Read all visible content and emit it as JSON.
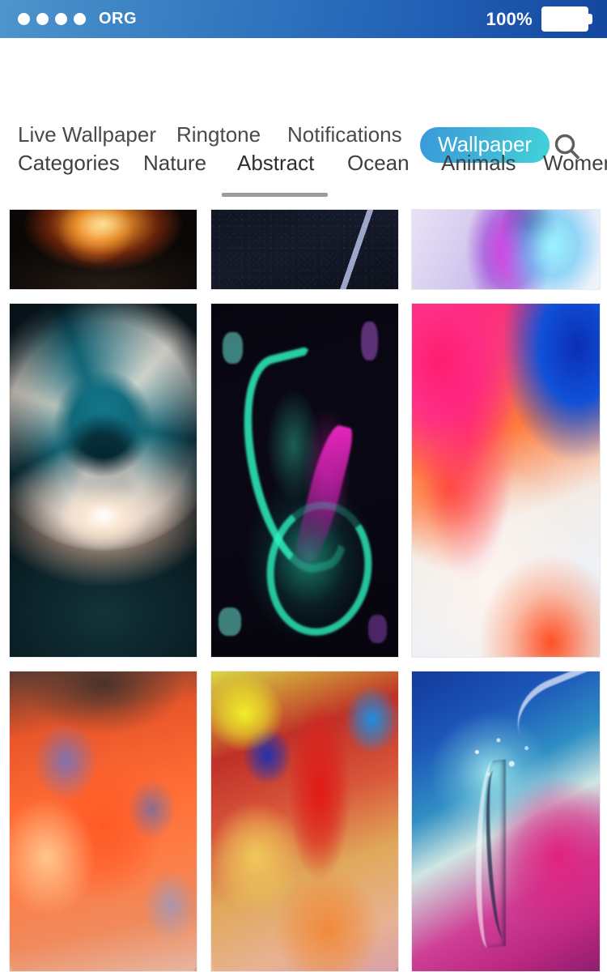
{
  "status_bar": {
    "signal_dots": 4,
    "carrier": "ORG",
    "battery_percent": "100%",
    "battery_icon": "battery-full-icon",
    "gradient_from": "#4d95cc",
    "gradient_to": "#14479f"
  },
  "top_nav": {
    "items": [
      {
        "label": "Live Wallpaper",
        "active": false
      },
      {
        "label": "Ringtone",
        "active": false
      },
      {
        "label": "Notifications",
        "active": false
      },
      {
        "label": "Wallpaper",
        "active": true
      }
    ],
    "active_pill_gradient_from": "#3a9ada",
    "active_pill_gradient_to": "#41d2d9",
    "active_pill_text_color": "#ffffff",
    "search_icon": "search-icon"
  },
  "categories": {
    "items": [
      {
        "label": "Categories",
        "active": false
      },
      {
        "label": "Nature",
        "active": false
      },
      {
        "label": "Abstract",
        "active": true
      },
      {
        "label": "Ocean",
        "active": false
      },
      {
        "label": "Animals",
        "active": false
      },
      {
        "label": "Women",
        "active": false
      }
    ],
    "active_index": 2,
    "underline_color": "#9b9b9b"
  },
  "gallery": {
    "columns": 3,
    "rows": [
      {
        "clipped": true,
        "tiles": [
          {
            "name": "wallpaper-campfire",
            "description": "Bonfire burning sticks at night"
          },
          {
            "name": "wallpaper-night-road",
            "description": "Dark asphalt road with lane marking"
          },
          {
            "name": "wallpaper-crystal-prism",
            "description": "Magenta and cyan crystal prism abstract"
          }
        ]
      },
      {
        "clipped": false,
        "tiles": [
          {
            "name": "wallpaper-cloud-vortex",
            "description": "Swirling cloud vortex with teal sky"
          },
          {
            "name": "wallpaper-neon-burst",
            "description": "Neon teal and magenta energy burst on black"
          },
          {
            "name": "wallpaper-iphone-gradient",
            "description": "Pink blue orange blurred gradient"
          }
        ]
      },
      {
        "clipped": true,
        "tiles": [
          {
            "name": "wallpaper-orange-paint",
            "description": "Orange and blue paint cloud explosion"
          },
          {
            "name": "wallpaper-multicolor-paint",
            "description": "Yellow red blue paint cloud explosion"
          },
          {
            "name": "wallpaper-water-splash",
            "description": "Water splash on blue to magenta gradient"
          }
        ]
      }
    ]
  }
}
